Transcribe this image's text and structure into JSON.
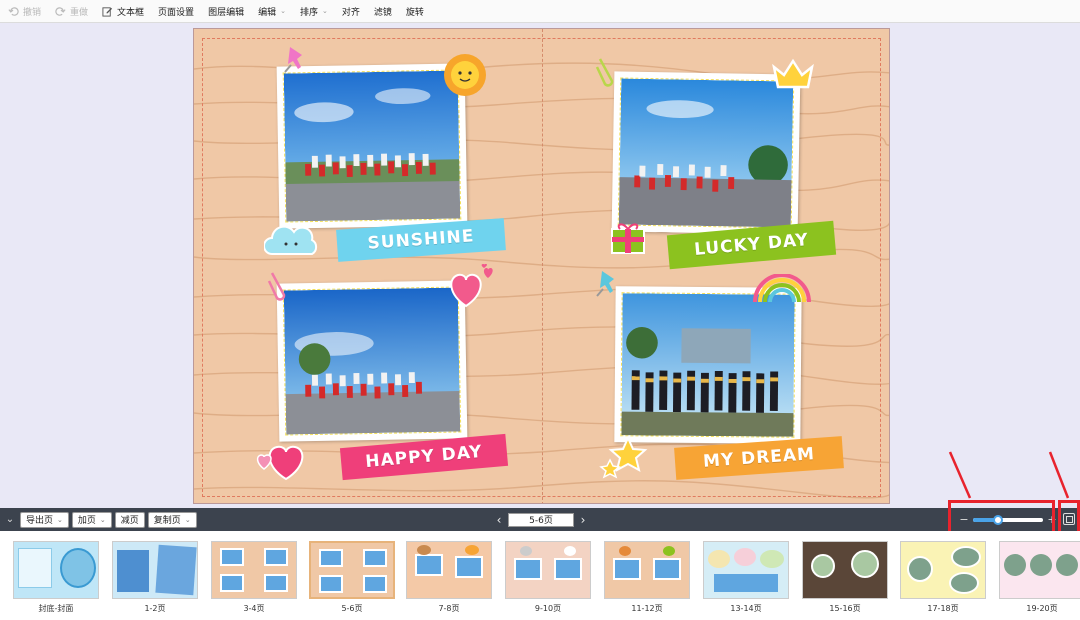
{
  "toolbar": {
    "items": [
      {
        "label": "撤销",
        "icon": "undo-icon",
        "disabled": true
      },
      {
        "label": "重做",
        "icon": "redo-icon",
        "disabled": true
      },
      {
        "label": "文本框",
        "icon": "edit-icon",
        "disabled": false
      },
      {
        "label": "页面设置",
        "disabled": false
      },
      {
        "label": "图层编辑",
        "disabled": false
      },
      {
        "label": "编辑",
        "dropdown": true
      },
      {
        "label": "排序",
        "dropdown": true
      },
      {
        "label": "对齐"
      },
      {
        "label": "滤镜"
      },
      {
        "label": "旋转"
      }
    ]
  },
  "spread": {
    "banners": [
      {
        "text": "SUNSHINE",
        "color": "#6fd3ee"
      },
      {
        "text": "LUCKY DAY",
        "color": "#8cc21f"
      },
      {
        "text": "HAPPY DAY",
        "color": "#ef3f7a"
      },
      {
        "text": "MY DREAM",
        "color": "#f7a435"
      }
    ],
    "bg_color": "#f0c8a6",
    "frame_color": "#e07a5f"
  },
  "page_toolbar": {
    "export_label": "导出页",
    "add_label": "加页",
    "remove_label": "减页",
    "copy_label": "复制页",
    "current_page": "5-6页",
    "zoom_level": 0.35
  },
  "thumbnails": [
    {
      "label": "封底-封面",
      "theme": "#bfe6f7"
    },
    {
      "label": "1-2页",
      "theme": "#cde9f7"
    },
    {
      "label": "3-4页",
      "theme": "#f0c8a6"
    },
    {
      "label": "5-6页",
      "theme": "#f0c8a6",
      "active": true
    },
    {
      "label": "7-8页",
      "theme": "#f4c9a7"
    },
    {
      "label": "9-10页",
      "theme": "#f3d3c3"
    },
    {
      "label": "11-12页",
      "theme": "#f0c8a6"
    },
    {
      "label": "13-14页",
      "theme": "#d5edf6"
    },
    {
      "label": "15-16页",
      "theme": "#5a4638"
    },
    {
      "label": "17-18页",
      "theme": "#faf3b5"
    },
    {
      "label": "19-20页",
      "theme": "#fbe6ef"
    }
  ],
  "colors": {
    "highlight": "#e8232d",
    "dark_bar": "#3c434e",
    "accent": "#4aa3e8"
  }
}
